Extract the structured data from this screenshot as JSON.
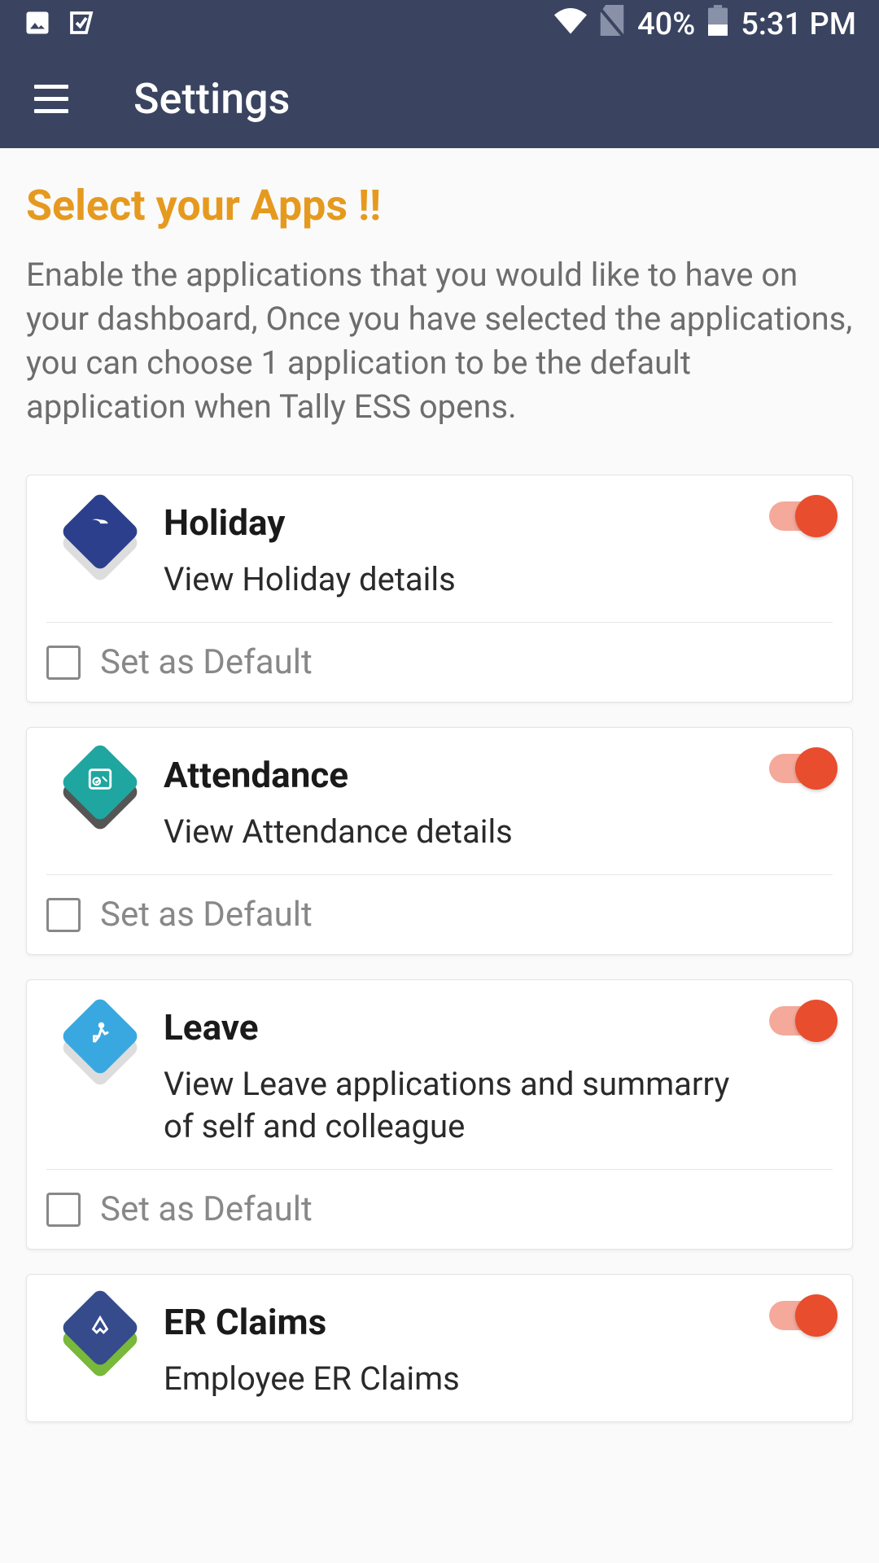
{
  "statusbar": {
    "battery_pct": "40%",
    "time": "5:31 PM"
  },
  "appbar": {
    "title": "Settings"
  },
  "page": {
    "heading": "Select your Apps !!",
    "description": "Enable the applications that you would like to have on your dashboard, Once you have selected the applications, you can choose 1 application to be the default application when Tally ESS opens."
  },
  "default_label": "Set as Default",
  "apps": [
    {
      "title": "Holiday",
      "desc": "View Holiday details",
      "enabled": true,
      "icon_color": "#2b3f8d"
    },
    {
      "title": "Attendance",
      "desc": "View Attendance details",
      "enabled": true,
      "icon_color": "#1fa6a0"
    },
    {
      "title": "Leave",
      "desc": "View Leave applications and summarry of self and colleague",
      "enabled": true,
      "icon_color": "#3aa8e0"
    },
    {
      "title": "ER Claims",
      "desc": "Employee ER Claims",
      "enabled": true,
      "icon_color": "#354b8c"
    }
  ]
}
